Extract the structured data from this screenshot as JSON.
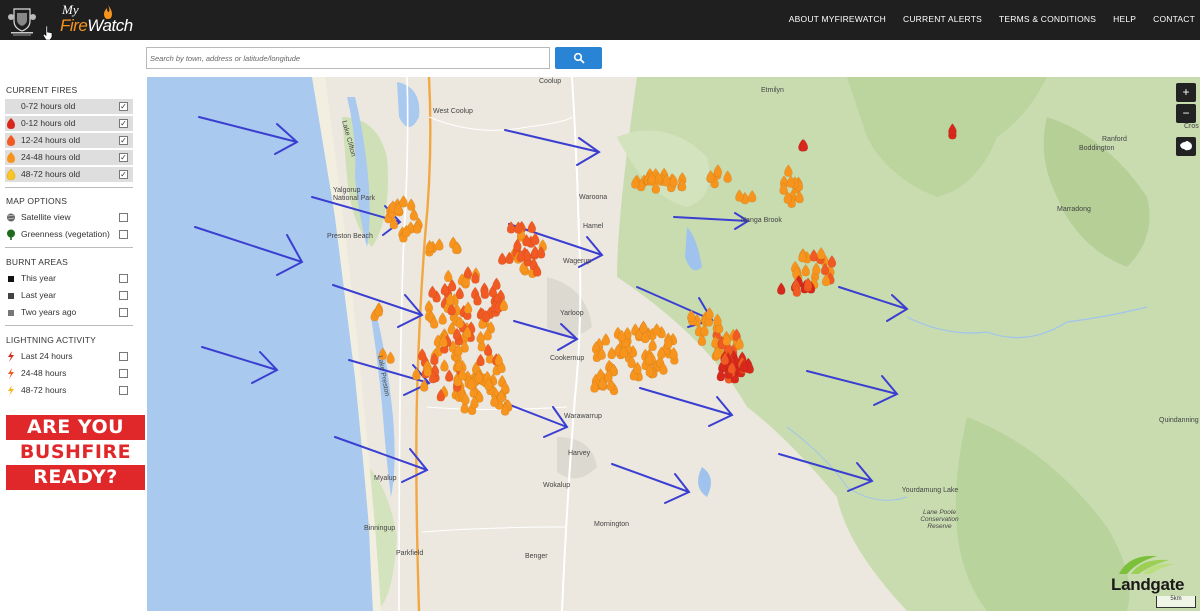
{
  "header": {
    "brand_my": "My",
    "brand_fire": "Fire",
    "brand_watch": "Watch",
    "nav": [
      "ABOUT MYFIREWATCH",
      "CURRENT ALERTS",
      "TERMS & CONDITIONS",
      "HELP",
      "CONTACT"
    ]
  },
  "search": {
    "placeholder": "Search by town, address or latitude/longitude",
    "button_icon": "search-icon"
  },
  "sidebar": {
    "current_fires": {
      "title": "CURRENT FIRES",
      "items": [
        {
          "label": "0-72 hours old",
          "checked": true,
          "icon": "none"
        },
        {
          "label": "0-12 hours old",
          "checked": true,
          "icon": "flame-red-icon",
          "color": "#d8281c"
        },
        {
          "label": "12-24 hours old",
          "checked": true,
          "icon": "flame-orange-icon",
          "color": "#f15a22"
        },
        {
          "label": "24-48 hours old",
          "checked": true,
          "icon": "flame-amber-icon",
          "color": "#f7941d"
        },
        {
          "label": "48-72 hours old",
          "checked": true,
          "icon": "flame-yellow-icon",
          "color": "#fcc526"
        }
      ]
    },
    "map_options": {
      "title": "MAP OPTIONS",
      "items": [
        {
          "label": "Satellite view",
          "checked": false,
          "icon": "satellite-icon"
        },
        {
          "label": "Greenness (vegetation)",
          "checked": false,
          "icon": "tree-icon"
        }
      ]
    },
    "burnt_areas": {
      "title": "BURNT AREAS",
      "items": [
        {
          "label": "This year",
          "checked": false,
          "icon": "square-black-icon"
        },
        {
          "label": "Last year",
          "checked": false,
          "icon": "square-dark-icon"
        },
        {
          "label": "Two years ago",
          "checked": false,
          "icon": "square-grey-icon"
        }
      ]
    },
    "lightning": {
      "title": "LIGHTNING ACTIVITY",
      "items": [
        {
          "label": "Last 24 hours",
          "checked": false,
          "icon": "lightning-red-icon"
        },
        {
          "label": "24-48 hours",
          "checked": false,
          "icon": "lightning-orange-icon"
        },
        {
          "label": "48-72 hours",
          "checked": false,
          "icon": "lightning-yellow-icon"
        }
      ]
    },
    "banner": [
      "ARE YOU",
      "BUSHFIRE",
      "READY?"
    ]
  },
  "map": {
    "places": [
      "Coolup",
      "Etmilyn",
      "West Coolup",
      "Ranford",
      "Boddington",
      "Waroona",
      "Marradong",
      "Yalgorup National Park",
      "Preston Beach",
      "Hamel",
      "Nanga Brook",
      "Wagerup",
      "Yarloop",
      "Cookernup",
      "Quindanning",
      "Warawarrup",
      "Harvey",
      "Wokalup",
      "Myalup",
      "Yourdamung Lake",
      "Lane Poole Conservation Reserve",
      "Binningup",
      "Mornington",
      "Parkfield",
      "Benger",
      "Lake Clifton",
      "Lake Preston",
      "Cros"
    ],
    "controls": {
      "zoom_in": "+",
      "zoom_out": "−"
    },
    "attribution": "Landgate",
    "scale": "5km"
  },
  "colors": {
    "header_bg": "#1f1f1f",
    "search_button": "#2a84d6",
    "banner_red": "#e0282b",
    "arrow": "#3a3fd1"
  }
}
